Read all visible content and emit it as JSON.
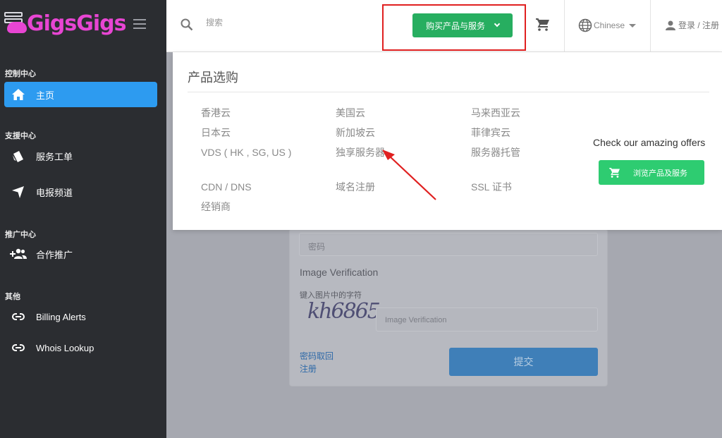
{
  "brand": {
    "name": "GigsGigs",
    "color": "#e845d3"
  },
  "sidebar": {
    "sections": [
      {
        "title": "控制中心"
      },
      {
        "title": "支援中心"
      },
      {
        "title": "推广中心"
      },
      {
        "title": "其他"
      }
    ],
    "items": [
      {
        "label": "主页",
        "icon": "home-icon",
        "active": true
      },
      {
        "label": "服务工单",
        "icon": "ticket-icon"
      },
      {
        "label": "电报频道",
        "icon": "send-icon"
      },
      {
        "label": "合作推广",
        "icon": "users-add-icon"
      },
      {
        "label": "Billing Alerts",
        "icon": "link-icon"
      },
      {
        "label": "Whois Lookup",
        "icon": "link-icon"
      }
    ]
  },
  "header": {
    "search_placeholder": "搜索",
    "buy_label": "购买产品与服务",
    "language": "Chinese",
    "login_label": "登录 / 注册"
  },
  "dropdown": {
    "title": "产品选购",
    "columns": [
      [
        "香港云",
        "日本云",
        "VDS ( HK , SG, US )",
        "CDN / DNS",
        "经销商"
      ],
      [
        "美国云",
        "新加坡云",
        "独享服务器",
        "域名注册"
      ],
      [
        "马来西亚云",
        "菲律宾云",
        "服务器托管",
        "SSL 证书"
      ]
    ],
    "offers_text": "Check our amazing offers",
    "browse_label": "浏览产品及服务"
  },
  "login_form": {
    "password_placeholder": "密码",
    "verification_heading": "Image Verification",
    "verification_hint": "键入图片中的字符",
    "captcha_text": "kh6865",
    "verification_placeholder": "Image Verification",
    "forgot_password": "密码取回",
    "register": "注册",
    "submit_label": "提交"
  },
  "colors": {
    "accent_green": "#27ae60",
    "active_blue": "#2d9bf0",
    "highlight_red": "#e02020"
  }
}
